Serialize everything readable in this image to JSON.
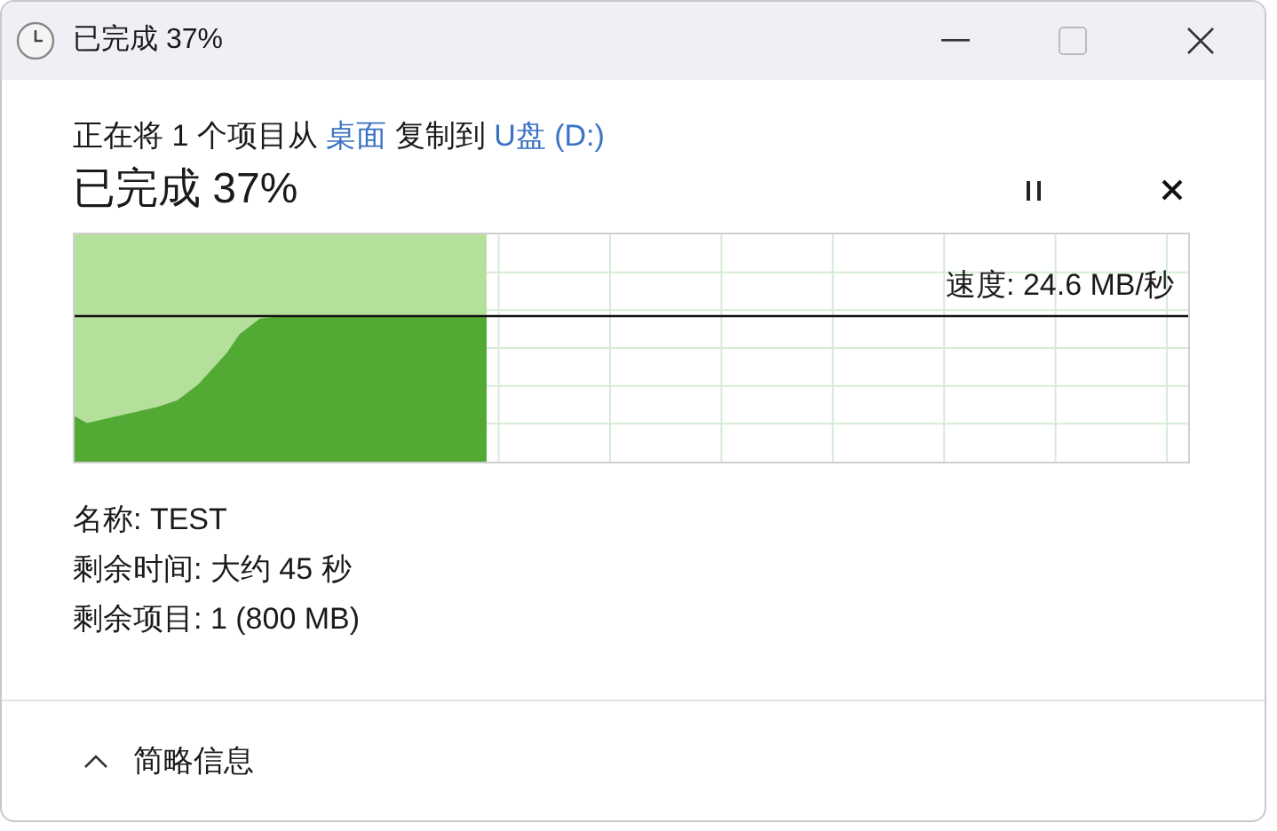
{
  "window": {
    "title": "已完成 37%"
  },
  "message": {
    "before": "正在将 1 个项目从",
    "source": "桌面",
    "middle": "复制到",
    "destination": "U盘 (D:)"
  },
  "progress": {
    "heading": "已完成 37%",
    "level": 0.37,
    "speed": "速度: 24.6 MB/秒"
  },
  "details": [
    "名称: TEST",
    "剩余时间: 大约 45 秒",
    "剩余项目: 1 (800 MB)"
  ],
  "footer": {
    "label": "简略信息",
    "expanded": true
  }
}
